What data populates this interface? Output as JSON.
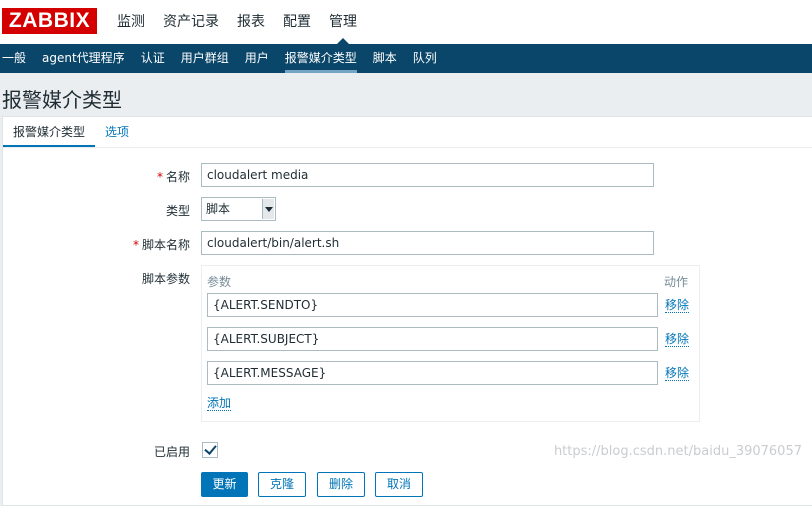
{
  "brand": {
    "logo_text": "ZABBIX",
    "color": "#d40000"
  },
  "top_nav": [
    "监测",
    "资产记录",
    "报表",
    "配置",
    "管理"
  ],
  "top_nav_active": "管理",
  "sub_nav": [
    "一般",
    "agent代理程序",
    "认证",
    "用户群组",
    "用户",
    "报警媒介类型",
    "脚本",
    "队列"
  ],
  "sub_nav_active": "报警媒介类型",
  "page_title": "报警媒介类型",
  "tabs": [
    {
      "label": "报警媒介类型",
      "active": true
    },
    {
      "label": "选项",
      "active": false
    }
  ],
  "form": {
    "name": {
      "label": "名称",
      "required": true,
      "value": "cloudalert media"
    },
    "type": {
      "label": "类型",
      "selected": "脚本"
    },
    "script_name": {
      "label": "脚本名称",
      "required": true,
      "value": "cloudalert/bin/alert.sh"
    },
    "script_params": {
      "label": "脚本参数",
      "col_param": "参数",
      "col_action": "动作",
      "rows": [
        {
          "value": "{ALERT.SENDTO}",
          "action": "移除"
        },
        {
          "value": "{ALERT.SUBJECT}",
          "action": "移除"
        },
        {
          "value": "{ALERT.MESSAGE}",
          "action": "移除"
        }
      ],
      "add_label": "添加"
    },
    "enabled": {
      "label": "已启用",
      "checked": true
    }
  },
  "buttons": {
    "update": "更新",
    "clone": "克隆",
    "delete": "删除",
    "cancel": "取消"
  },
  "watermark": "https://blog.csdn.net/baidu_39076057",
  "colors": {
    "nav_bg": "#0a466a",
    "link": "#0275b8",
    "page_bg": "#ebeef0"
  }
}
